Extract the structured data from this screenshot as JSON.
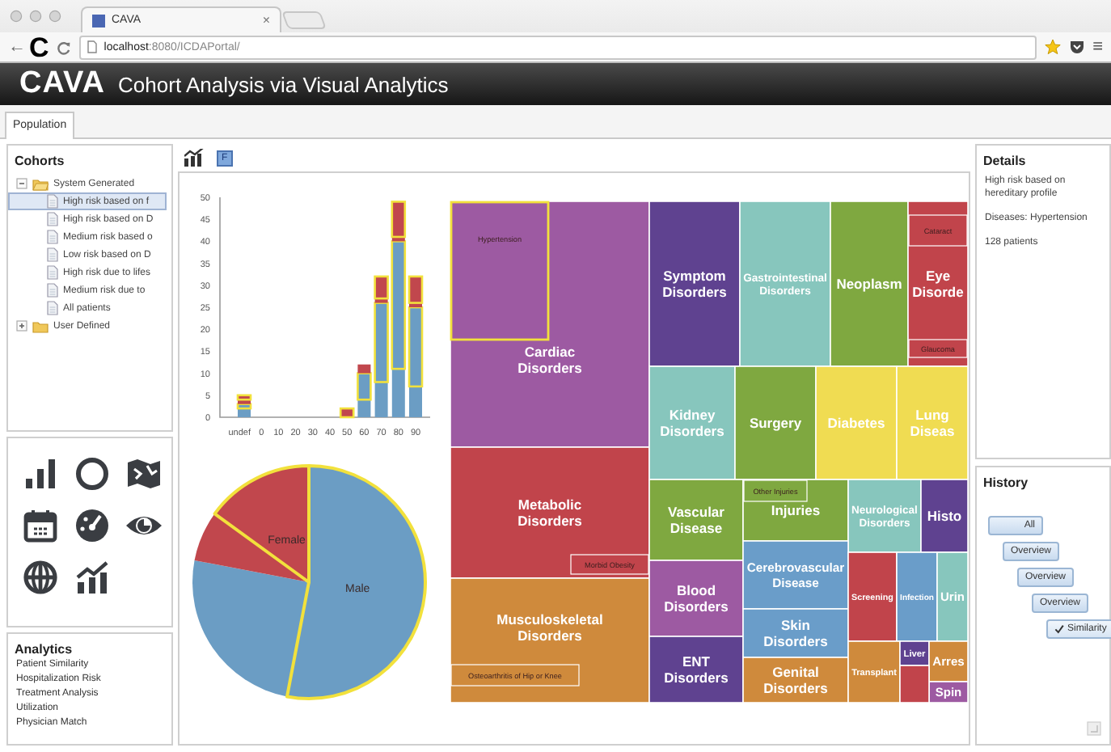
{
  "browser": {
    "tab_title": "CAVA",
    "tab_close": "×",
    "back": "←",
    "overlay_letter": "C",
    "url_host": "localhost",
    "url_path": ":8080/ICDAPortal/",
    "menu": "≡"
  },
  "app": {
    "logo": "CAVA",
    "title": "Cohort Analysis via Visual Analytics"
  },
  "tabs": [
    {
      "label": "Population",
      "selected": true
    }
  ],
  "cohorts": {
    "title": "Cohorts",
    "groups": [
      {
        "label": "System Generated",
        "expanded": true,
        "children": [
          {
            "label": "High risk based on f",
            "selected": true
          },
          {
            "label": "High risk based on D",
            "selected": false
          },
          {
            "label": "Medium risk based o",
            "selected": false
          },
          {
            "label": "Low risk based on D",
            "selected": false
          },
          {
            "label": "High risk due to lifes",
            "selected": false
          },
          {
            "label": "Medium risk due to",
            "selected": false
          },
          {
            "label": "All patients",
            "selected": false
          }
        ]
      },
      {
        "label": "User Defined",
        "expanded": false
      }
    ]
  },
  "analytics": {
    "title": "Analytics",
    "items": [
      "Patient Similarity",
      "Hospitalization Risk",
      "Treatment Analysis",
      "Utilization",
      "Physician Match"
    ]
  },
  "toolbar": {
    "button": "F"
  },
  "histogram": {
    "chart_data": {
      "type": "bar",
      "stacked": true,
      "categories": [
        "undef",
        "0",
        "10",
        "20",
        "30",
        "40",
        "50",
        "60",
        "70",
        "80",
        "90"
      ],
      "ylim": [
        0,
        50
      ],
      "yticks": [
        0,
        5,
        10,
        15,
        20,
        25,
        30,
        35,
        40,
        45,
        50
      ],
      "series": [
        {
          "color": "#6b9dc4",
          "values": [
            2,
            0,
            0,
            0,
            0,
            0,
            0,
            4,
            8,
            11,
            7
          ]
        },
        {
          "color": "#6b9dc4",
          "values": [
            1,
            0,
            0,
            0,
            0,
            0,
            0,
            6,
            18,
            29,
            18
          ]
        },
        {
          "color": "#c1474d",
          "values": [
            1,
            0,
            0,
            0,
            0,
            0,
            0,
            2,
            1,
            1,
            1
          ]
        },
        {
          "color": "#c1474d",
          "values": [
            1,
            0,
            0,
            0,
            0,
            0,
            2,
            0,
            5,
            8,
            6
          ]
        }
      ]
    },
    "series_states": [
      {
        "selected": false
      },
      {
        "selected": true
      },
      {
        "selected": false
      },
      {
        "selected": true
      }
    ]
  },
  "pie": {
    "chart_data": {
      "type": "pie",
      "values": [
        53,
        25,
        7,
        15
      ]
    },
    "slices": [
      {
        "color": "#6b9dc4",
        "selected": true,
        "label": "Male"
      },
      {
        "color": "#6b9dc4",
        "selected": false
      },
      {
        "color": "#c1474d",
        "selected": false
      },
      {
        "color": "#c1474d",
        "selected": true,
        "label": "Female"
      }
    ]
  },
  "treemap": {
    "cells": [
      {
        "kind": "group",
        "label": "Cardiac Disorders",
        "color": "#9d5aa2"
      },
      {
        "kind": "group",
        "label": "Metabolic Disorders",
        "color": "#c1444b"
      },
      {
        "kind": "group",
        "label": "Musculoskeletal Disorders",
        "color": "#cf8a3c"
      },
      {
        "kind": "group",
        "label": "Symptom Disorders",
        "color": "#5f4290"
      },
      {
        "kind": "group",
        "label": "Gastrointestinal Disorders",
        "color": "#87c6bd"
      },
      {
        "kind": "group",
        "label": "Neoplasm",
        "color": "#7fa840"
      },
      {
        "kind": "group",
        "label": "Eye Disorde",
        "color": "#c1444b"
      },
      {
        "kind": "group",
        "label": "Kidney Disorders",
        "color": "#87c6bd"
      },
      {
        "kind": "group",
        "label": "Surgery",
        "color": "#7fa840"
      },
      {
        "kind": "group",
        "label": "Diabetes",
        "color": "#f0dc52"
      },
      {
        "kind": "group",
        "label": "Lung Diseas",
        "color": "#f0dc52"
      },
      {
        "kind": "group",
        "label": "Vascular Disease",
        "color": "#7fa840"
      },
      {
        "kind": "group",
        "label": "Injuries",
        "color": "#7fa840"
      },
      {
        "kind": "group",
        "label": "Neurological Disorders",
        "color": "#87c6bd"
      },
      {
        "kind": "group",
        "label": "Histo",
        "color": "#5f4290"
      },
      {
        "kind": "group",
        "label": "Blood Disorders",
        "color": "#9d5aa2"
      },
      {
        "kind": "group",
        "label": "ENT Disorders",
        "color": "#5f4290"
      },
      {
        "kind": "group",
        "label": "Cerebrovascular Disease",
        "color": "#6a9dc9"
      },
      {
        "kind": "group",
        "label": "Skin Disorders",
        "color": "#6a9dc9"
      },
      {
        "kind": "group",
        "label": "Genital Disorders",
        "color": "#cf8a3c"
      },
      {
        "kind": "group",
        "label": "Screening",
        "color": "#c1444b"
      },
      {
        "kind": "group",
        "label": "Infection",
        "color": "#6a9dc9"
      },
      {
        "kind": "group",
        "label": "Urin",
        "color": "#87c6bd"
      },
      {
        "kind": "group",
        "label": "Transplant",
        "color": "#cf8a3c"
      },
      {
        "kind": "group",
        "label": "Liver",
        "color": "#5f4290"
      },
      {
        "kind": "group",
        "label": "Arres",
        "color": "#cf8a3c"
      },
      {
        "kind": "group",
        "label": "Spin",
        "color": "#9d5aa2"
      },
      {
        "kind": "sub",
        "label": "Hypertension",
        "selected": true
      },
      {
        "kind": "sub",
        "label": "Morbid Obesity",
        "selected": false
      },
      {
        "kind": "sub",
        "label": "Osteoarthritis of Hip or Knee",
        "selected": false
      },
      {
        "kind": "sub",
        "label": "Cataract",
        "selected": false
      },
      {
        "kind": "sub",
        "label": "Glaucoma",
        "selected": false
      },
      {
        "kind": "sub",
        "label": "Other Injuries",
        "selected": false
      }
    ]
  },
  "details": {
    "title": "Details",
    "lines": [
      "High risk based on hereditary profile",
      "Diseases: Hypertension",
      "128 patients"
    ]
  },
  "history": {
    "title": "History",
    "steps": [
      {
        "label": "All",
        "checked": false
      },
      {
        "label": "Overview",
        "checked": false
      },
      {
        "label": "Overview",
        "checked": false
      },
      {
        "label": "Overview",
        "checked": false
      },
      {
        "label": "Similarity",
        "checked": true
      }
    ]
  }
}
